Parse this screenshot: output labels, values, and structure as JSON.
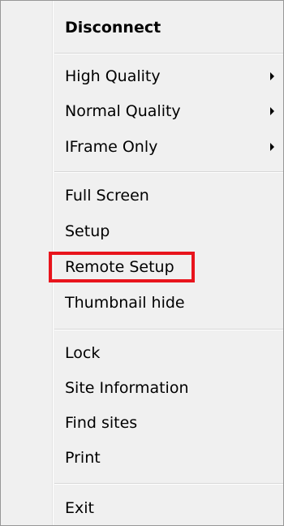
{
  "menu": {
    "items": [
      {
        "label": "Disconnect"
      },
      {
        "label": "High Quality"
      },
      {
        "label": "Normal Quality"
      },
      {
        "label": "IFrame Only"
      },
      {
        "label": "Full Screen"
      },
      {
        "label": "Setup"
      },
      {
        "label": "Remote Setup"
      },
      {
        "label": "Thumbnail hide"
      },
      {
        "label": "Lock"
      },
      {
        "label": "Site Information"
      },
      {
        "label": "Find sites"
      },
      {
        "label": "Print"
      },
      {
        "label": "Exit"
      }
    ],
    "highlight_color": "#e8141c",
    "submenu_icon": "triangle-right-icon"
  }
}
